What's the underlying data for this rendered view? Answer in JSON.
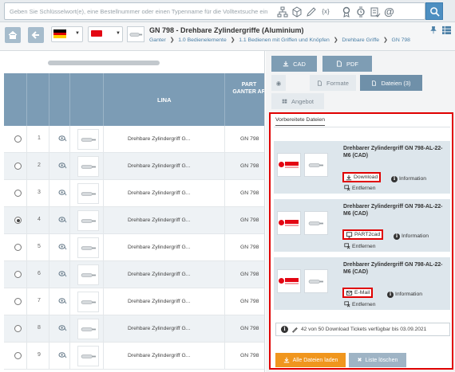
{
  "search": {
    "placeholder": "Geben Sie Schlüsselwort(e), eine Bestellnummer oder einen Typenname für die Volltextsuche ein",
    "icons": [
      "network-icon",
      "cube-icon",
      "pencil-icon",
      "formula-icon",
      "compare-icon",
      "watch-icon",
      "checklist-icon",
      "at-icon",
      "search-icon"
    ],
    "formula_glyph": "{x}",
    "at_glyph": "@"
  },
  "header": {
    "title": "GN 798 - Drehbare Zylindergriffe (Aluminium)",
    "breadcrumb": [
      "Ganter",
      "1.0 Bedienelemente",
      "1.1 Bedienen mit Griffen und Knöpfen",
      "Drehbare Griffe",
      "GN 798"
    ],
    "breadcrumb_sep": "❯",
    "language": "de",
    "pin_glyph": "📌",
    "grid_glyph": "⊞"
  },
  "table": {
    "columns": [
      "LINA",
      "PART",
      "GANTER AR"
    ],
    "rows": [
      {
        "num": "1",
        "name": "Drehbare Zylindergriff G...",
        "part": "GN 798",
        "selected": false
      },
      {
        "num": "2",
        "name": "Drehbare Zylindergriff G...",
        "part": "GN 798",
        "selected": false
      },
      {
        "num": "3",
        "name": "Drehbare Zylindergriff G...",
        "part": "GN 798",
        "selected": false
      },
      {
        "num": "4",
        "name": "Drehbare Zylindergriff G...",
        "part": "GN 798",
        "selected": true
      },
      {
        "num": "5",
        "name": "Drehbare Zylindergriff G...",
        "part": "GN 798",
        "selected": false
      },
      {
        "num": "6",
        "name": "Drehbare Zylindergriff G...",
        "part": "GN 798",
        "selected": false
      },
      {
        "num": "7",
        "name": "Drehbare Zylindergriff G...",
        "part": "GN 798",
        "selected": false
      },
      {
        "num": "8",
        "name": "Drehbare Zylindergriff G...",
        "part": "GN 798",
        "selected": false
      },
      {
        "num": "9",
        "name": "Drehbare Zylindergriff G...",
        "part": "GN 798",
        "selected": false
      }
    ]
  },
  "tabs": {
    "cad": "CAD",
    "pdf": "PDF",
    "formate": "Formate",
    "dateien": "Dateien (3)",
    "angebot": "Angebot"
  },
  "files": {
    "subtab": "Vorbereitete Dateien",
    "cards": [
      {
        "title": "Drehbarer Zylindergriff GN 798-AL-22-M6 (CAD)",
        "action": "Download",
        "action_icon": "download-icon",
        "info": "Information",
        "remove": "Entfernen"
      },
      {
        "title": "Drehbarer Zylindergriff GN 798-AL-22-M6 (CAD)",
        "action": "PART2cad",
        "action_icon": "monitor-icon",
        "info": "Information",
        "remove": "Entfernen"
      },
      {
        "title": "Drehbarer Zylindergriff GN 798-AL-22-M6 (CAD)",
        "action": "E-Mail",
        "action_icon": "email-icon",
        "info": "Information",
        "remove": "Entfernen"
      }
    ],
    "brand": "Ganter",
    "brand_sub": "GRIFF",
    "tickets": "42 von 50 Download Tickets verfügbar bis 03.09.2021",
    "load_all": "Alle Dateien laden",
    "clear_list": "Liste löschen"
  },
  "colors": {
    "accent": "#4d8fc1",
    "table_header": "#7c9cb5",
    "highlight": "#e00000",
    "load_button": "#f0961e",
    "clear_button": "#9fb4c5"
  }
}
